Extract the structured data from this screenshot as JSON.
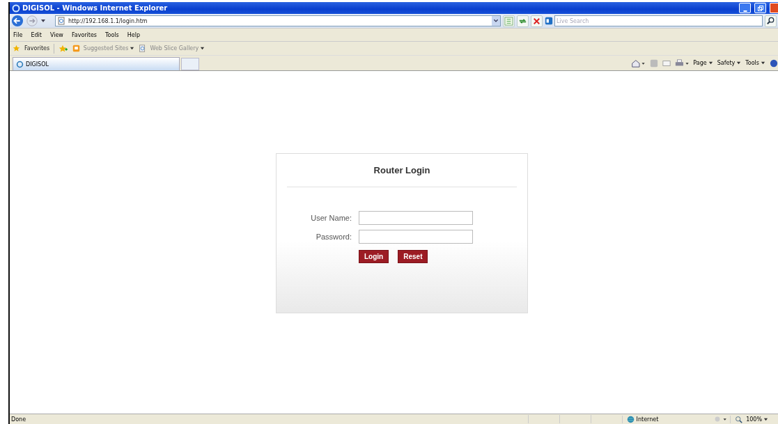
{
  "window": {
    "title": "DIGISOL - Windows Internet Explorer"
  },
  "address_bar": {
    "url": "http://192.168.1.1/login.htm"
  },
  "search": {
    "placeholder": "Live Search"
  },
  "menu": [
    "File",
    "Edit",
    "View",
    "Favorites",
    "Tools",
    "Help"
  ],
  "favorites_bar": {
    "label": "Favorites",
    "items": [
      {
        "label": "Suggested Sites",
        "kind": "suggested"
      },
      {
        "label": "Web Slice Gallery",
        "kind": "slice"
      }
    ]
  },
  "tabs": [
    {
      "label": "DIGISOL",
      "selected": true
    }
  ],
  "command_bar": [
    "Page",
    "Safety",
    "Tools"
  ],
  "login": {
    "title": "Router Login",
    "fields": [
      {
        "label": "User Name:"
      },
      {
        "label": "Password:"
      }
    ],
    "buttons": [
      "Login",
      "Reset"
    ]
  },
  "status_bar": {
    "text": "Done",
    "zone": "Internet",
    "zoom": "100%"
  }
}
